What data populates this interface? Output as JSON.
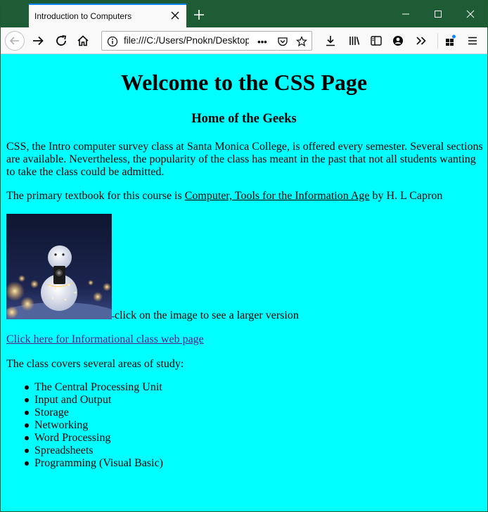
{
  "browser": {
    "tab_title": "Introduction to Computers",
    "url": "file:///C:/Users/Pnokn/Desktop/",
    "page_actions": "•••"
  },
  "page": {
    "heading": "Welcome to the CSS Page",
    "subheading": "Home of the Geeks",
    "intro": "CSS, the Intro computer survey class at Santa Monica College, is offered every semester. Several sections are available. Nevertheless, the popularity of the class has meant in the past that not all students wanting to take the class could be admitted.",
    "textbook_prefix": "The primary textbook for this course is ",
    "textbook_title": "Computer, Tools for the Information Age",
    "textbook_suffix": " by H. L Capron",
    "image_caption": "click on the image to see a larger version",
    "info_link": "Click here for Informational class web page",
    "areas_intro": "The class covers several areas of study:",
    "topics": [
      "The Central Processing Unit",
      "Input and Output",
      "Storage",
      "Networking",
      "Word Processing",
      "Spreadsheets",
      "Programming (Visual Basic)"
    ]
  },
  "colors": {
    "page_background": "#00ffff",
    "visited_link": "#551a8b",
    "titlebar": "#1d5c35",
    "tab_accent": "#0a84ff"
  }
}
